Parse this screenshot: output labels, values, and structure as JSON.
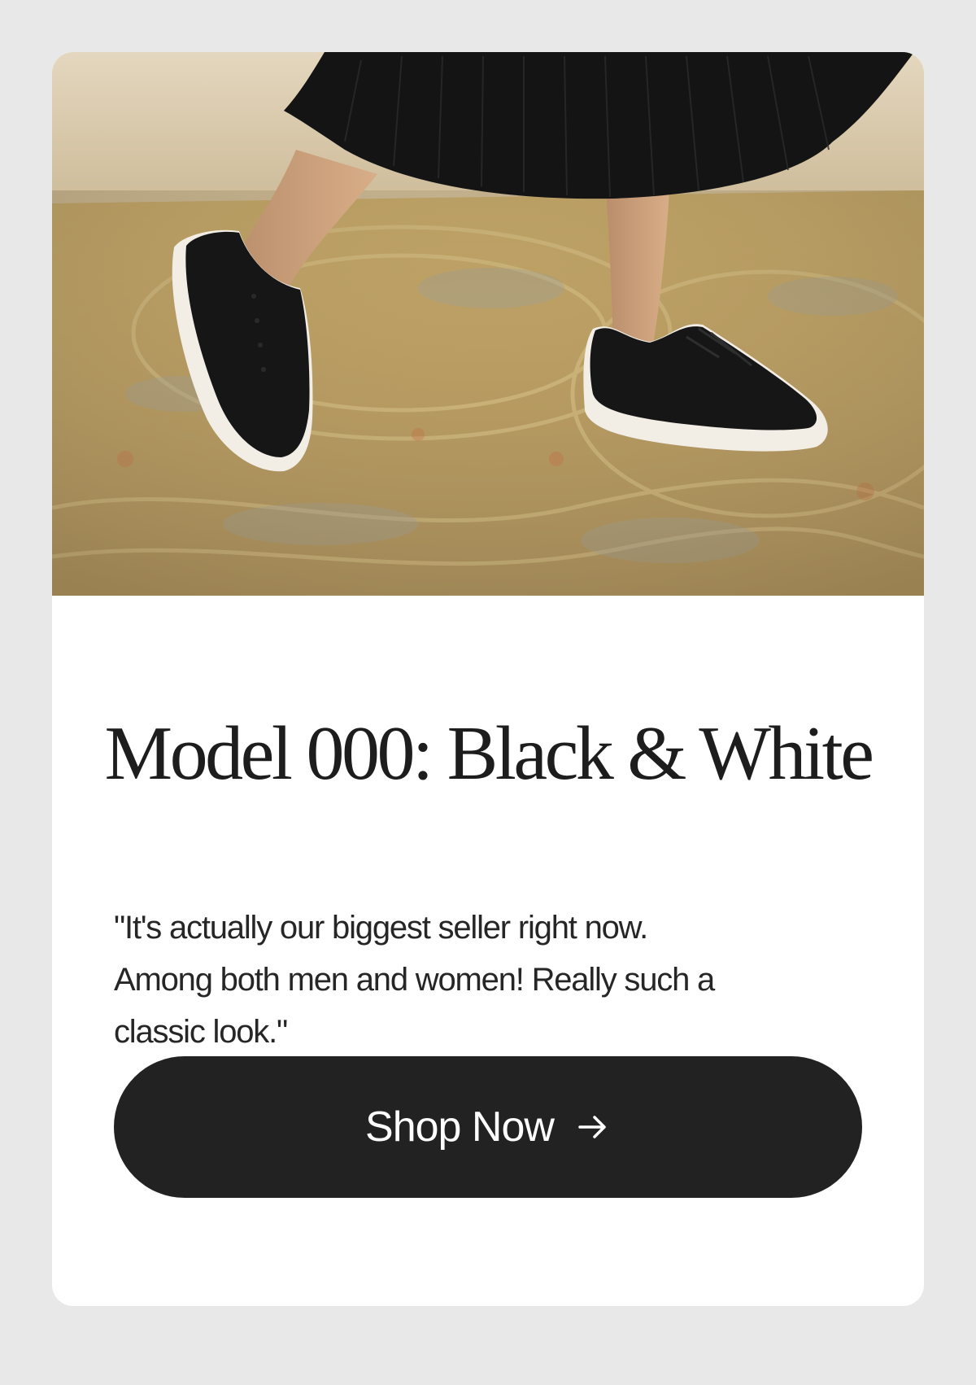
{
  "product_card": {
    "image": {
      "alt": "Person wearing black sneakers with white soles on a patterned rug",
      "colors": {
        "wall": "#d8c9ad",
        "rug": "#b79b5f",
        "skirt": "#111111",
        "shoe_upper": "#161616",
        "shoe_sole": "#f3efe8"
      }
    },
    "title": "Model 000: Black & White",
    "quote_lines": [
      "\"It's actually our biggest seller right now.",
      "Among both men and women! Really such a",
      "classic look.\""
    ],
    "button": {
      "label": "Shop Now",
      "icon": "arrow-right-icon"
    }
  },
  "colors": {
    "page_background": "#e8e8e8",
    "card_background": "#ffffff",
    "text": "#1d1d1d",
    "button_background": "#222222",
    "button_text": "#ffffff"
  }
}
